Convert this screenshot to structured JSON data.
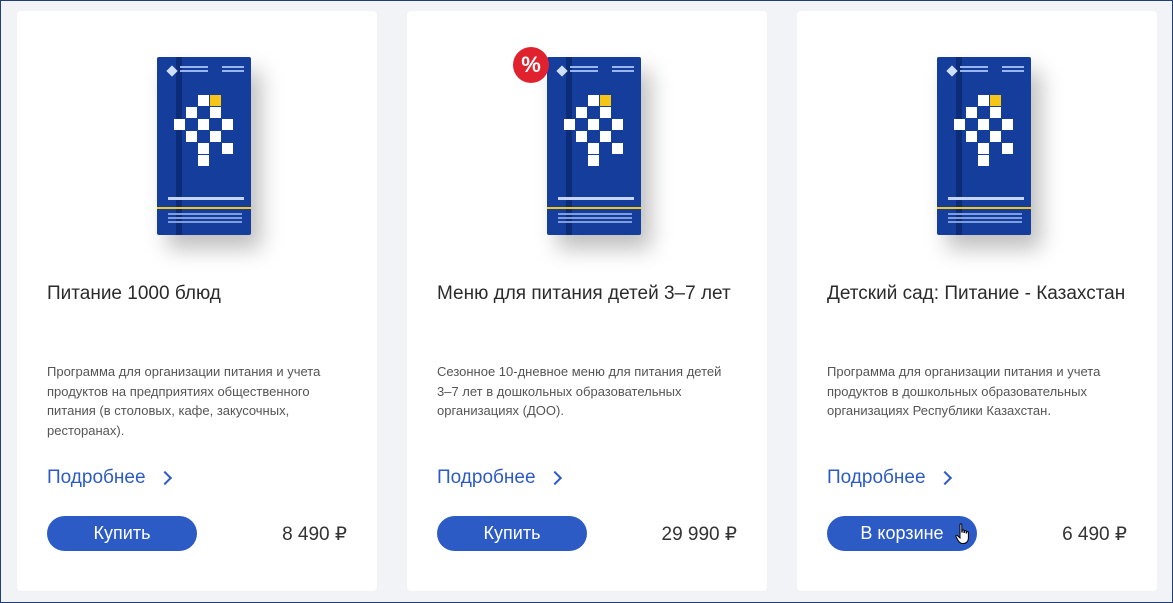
{
  "products": [
    {
      "title": "Питание 1000 блюд",
      "description": "Программа для организации питания и учета продуктов на предприятиях общественного питания (в столовых, кафе, закусочных, ресторанах).",
      "more_label": "Подробнее",
      "button_label": "Купить",
      "price": "8 490 ₽",
      "discount": false,
      "in_cart": false
    },
    {
      "title": "Меню для питания детей 3–7 лет",
      "description": "Сезонное 10-дневное меню для питания детей 3–7 лет в дошкольных образовательных организациях (ДОО).",
      "more_label": "Подробнее",
      "button_label": "Купить",
      "price": "29 990 ₽",
      "discount": true,
      "discount_label": "%",
      "in_cart": false
    },
    {
      "title": "Детский сад: Питание - Казахстан",
      "description": "Программа для организации питания и учета продуктов в дошкольных образовательных организациях Республики Казахстан.",
      "more_label": "Подробнее",
      "button_label": "В корзине",
      "price": "6 490 ₽",
      "discount": false,
      "in_cart": true
    }
  ],
  "colors": {
    "accent": "#2d5bc6",
    "box_blue": "#143d9c",
    "badge_red": "#e0222f",
    "pixel_yellow": "#f5c518",
    "page_bg": "#f1f3f7"
  }
}
